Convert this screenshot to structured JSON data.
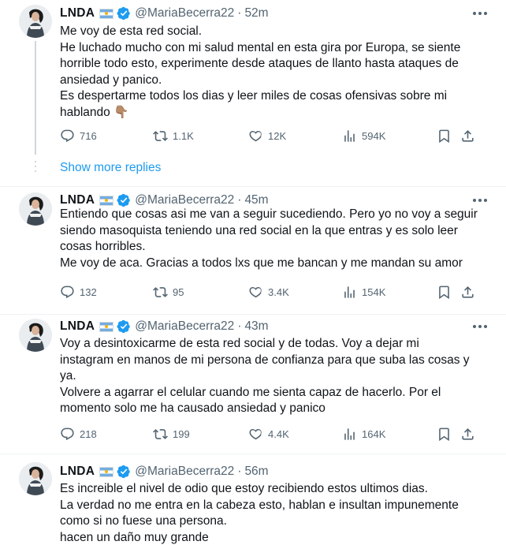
{
  "tweets": [
    {
      "name": "LNDA",
      "handle": "@MariaBecerra22",
      "separator": "·",
      "time": "52m",
      "lines": [
        "Me voy de esta red social.",
        "He luchado mucho con mi salud mental en esta gira por Europa, se siente",
        "horrible todo esto, experimente desde ataques de llanto hasta ataques de",
        "ansiedad y panico.",
        "Es despertarme todos los dias y leer miles de cosas ofensivas sobre mi",
        "hablando 👇🏽"
      ],
      "replies": "716",
      "reposts": "1.1K",
      "likes": "12K",
      "views": "594K"
    },
    {
      "name": "LNDA",
      "handle": "@MariaBecerra22",
      "separator": "·",
      "time": "45m",
      "lines": [
        "Entiendo que cosas asi me van a seguir sucediendo. Pero yo no voy a seguir",
        "siendo masoquista teniendo una red social en la que entras y es solo leer",
        "cosas horribles.",
        "Me voy de aca. Gracias a todos lxs que me bancan y me mandan su amor"
      ],
      "replies": "132",
      "reposts": "95",
      "likes": "3.4K",
      "views": "154K"
    },
    {
      "name": "LNDA",
      "handle": "@MariaBecerra22",
      "separator": "·",
      "time": "43m",
      "lines": [
        "Voy a desintoxicarme de esta red social y de todas. Voy a dejar mi",
        "instagram en manos de mi persona de confianza para que suba las cosas y",
        "ya.",
        "Volvere a agarrar el celular cuando me sienta capaz de hacerlo. Por el",
        "momento solo me ha causado ansiedad y panico"
      ],
      "replies": "218",
      "reposts": "199",
      "likes": "4.4K",
      "views": "164K"
    },
    {
      "name": "LNDA",
      "handle": "@MariaBecerra22",
      "separator": "·",
      "time": "56m",
      "lines": [
        "Es increible el nivel de odio que estoy recibiendo estos ultimos dias.",
        "La verdad no me entra en la cabeza esto, hablan e insultan impunemente",
        "como si no fuese una persona.",
        "hacen un daño muy grande"
      ]
    }
  ],
  "show_more_replies": "Show more replies",
  "colors": {
    "accent": "#1d9bf0",
    "text": "#0f1419",
    "secondary": "#536471",
    "thread_line": "#cfd9de"
  },
  "icons": [
    "avatar-photo",
    "argentina-flag-icon",
    "verified-badge-icon",
    "more-icon",
    "reply-icon",
    "repost-icon",
    "like-icon",
    "views-icon",
    "bookmark-icon",
    "share-icon"
  ]
}
